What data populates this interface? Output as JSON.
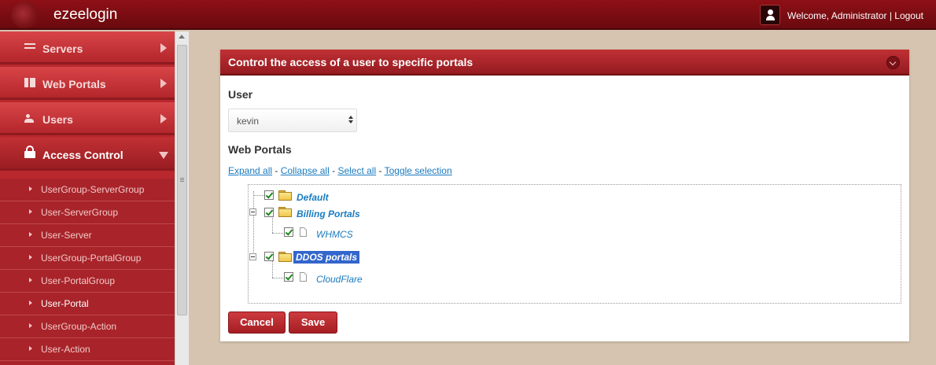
{
  "app": {
    "title": "ezeelogin"
  },
  "header": {
    "welcome": "Welcome, Administrator | Logout"
  },
  "sidebar": {
    "items": [
      {
        "label": "Servers",
        "icon": "list-icon"
      },
      {
        "label": "Web Portals",
        "icon": "grid-icon"
      },
      {
        "label": "Users",
        "icon": "users-icon"
      },
      {
        "label": "Access Control",
        "icon": "lock-icon",
        "expanded": true
      }
    ],
    "subitems": [
      "UserGroup-ServerGroup",
      "User-ServerGroup",
      "User-Server",
      "UserGroup-PortalGroup",
      "User-PortalGroup",
      "User-Portal",
      "UserGroup-Action",
      "User-Action"
    ],
    "active_subitem": "User-Portal"
  },
  "panel": {
    "title": "Control the access of a user to specific portals",
    "user_label": "User",
    "user_value": "kevin",
    "portals_label": "Web Portals",
    "links": {
      "expand_all": "Expand all",
      "collapse_all": "Collapse all",
      "select_all": "Select all",
      "toggle_selection": "Toggle selection",
      "separator": " - "
    },
    "tree": {
      "default": "Default",
      "billing": "Billing Portals",
      "whmcs": "WHMCS",
      "ddos": "DDOS portals",
      "cloudflare": "CloudFlare"
    },
    "buttons": {
      "cancel": "Cancel",
      "save": "Save"
    }
  },
  "colors": {
    "brand_red": "#a51e23",
    "link_blue": "#1a7bbf",
    "selected_blue": "#3366cc"
  }
}
